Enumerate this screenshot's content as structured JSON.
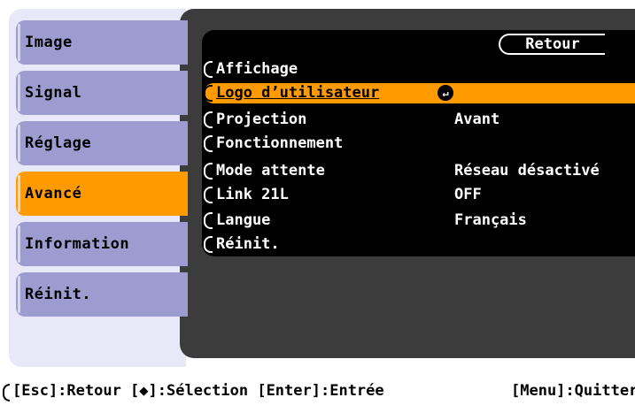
{
  "sidebar": {
    "items": [
      {
        "label": "Image",
        "active": false
      },
      {
        "label": "Signal",
        "active": false
      },
      {
        "label": "Réglage",
        "active": false
      },
      {
        "label": "Avancé",
        "active": true
      },
      {
        "label": "Information",
        "active": false
      },
      {
        "label": "Réinit.",
        "active": false
      }
    ]
  },
  "submenu": {
    "back_label": "Retour",
    "items": [
      {
        "label": "Affichage",
        "value": ""
      },
      {
        "label": "Logo d’utilisateur",
        "value": "",
        "selected": true
      },
      {
        "label": "Projection",
        "value": "Avant"
      },
      {
        "label": "Fonctionnement",
        "value": ""
      },
      {
        "label": "Mode attente",
        "value": "Réseau désactivé"
      },
      {
        "label": "Link 21L",
        "value": "OFF"
      },
      {
        "label": "Langue",
        "value": "Français"
      },
      {
        "label": "Réinit.",
        "value": ""
      }
    ],
    "enter_icon": "enter-return-icon"
  },
  "help": {
    "navigation": "[Esc]:Retour [◆]:Sélection [Enter]:Entrée",
    "quit": "[Menu]:Quitter"
  },
  "colors": {
    "active": "#ff9a00",
    "tab": "#9c9cd0",
    "panel": "#3c3c3c",
    "submenu": "#000000"
  }
}
